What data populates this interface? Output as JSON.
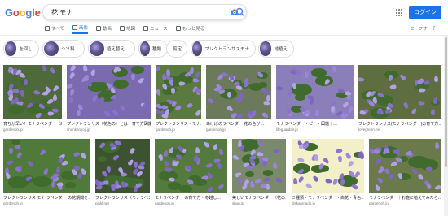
{
  "logo": [
    "G",
    "o",
    "o",
    "g",
    "l",
    "e"
  ],
  "search": {
    "query": "花 モナ"
  },
  "header": {
    "login_label": "ログイン"
  },
  "tabs": [
    {
      "label": "すべて",
      "active": false
    },
    {
      "label": "画像",
      "active": true
    },
    {
      "label": "動画",
      "active": false
    },
    {
      "label": "地図",
      "active": false
    },
    {
      "label": "ニュース",
      "active": false
    },
    {
      "label": "もっと見る",
      "active": false
    }
  ],
  "safesearch_label": "セーフサーチ",
  "chips": [
    {
      "label": "を回し",
      "thumb": true
    },
    {
      "label": "シソ科",
      "thumb": true
    },
    {
      "label": "植え替え",
      "thumb": true
    },
    {
      "label": "種類",
      "thumb": true
    },
    {
      "label": "剪定",
      "thumb": false
    },
    {
      "label": "プレクトランサスモナ",
      "thumb": true
    },
    {
      "label": "地植え",
      "thumb": true
    }
  ],
  "results_row1": [
    {
      "title": "育ちが早い！モナラベンダー（白や紫の花）…",
      "source": "gardenoh.jp"
    },
    {
      "title": "プレクトランサス（花色の）とは｜育て方図鑑…",
      "source": "shunkenyoji.jp"
    },
    {
      "title": "プレクトランサス・モナ…",
      "source": "gardenoh.jp"
    },
    {
      "title": "あけぼのラベンダー 花の色が…",
      "source": "gardenoh.jp"
    },
    {
      "title": "モナラベンダー・ピー・図鑑｜…",
      "source": "lifeguardair.jp"
    },
    {
      "title": "プレクトランサス(モナラベンダー)の育て方…",
      "source": "lovegreen.net"
    }
  ],
  "results_row2": [
    {
      "title": "プレクトランサス モナ ラベンダー の花期間を…",
      "source": "gardenoh.jp"
    },
    {
      "title": "プレクトランサス（モナラベン…",
      "source": "pinkl.net"
    },
    {
      "title": "モナラベンダー の育て方・冬越し…",
      "source": "gardenoh.jp"
    },
    {
      "title": "美しいモナラベンダー（花の…",
      "source": "shop.jp"
    },
    {
      "title": "ミ種類・モナラベンダー・白花・青色…",
      "source": "diskanmado.jp"
    },
    {
      "title": "モナラベンダー｜お庭に植えてみたら…",
      "source": "gardenoh.jp"
    }
  ],
  "colors": {
    "accent": "#1a73e8",
    "flower": "#9b86d8",
    "leaf": "#3f6b2c"
  },
  "icons": [
    "camera-icon",
    "search-icon",
    "apps-grid-icon"
  ]
}
